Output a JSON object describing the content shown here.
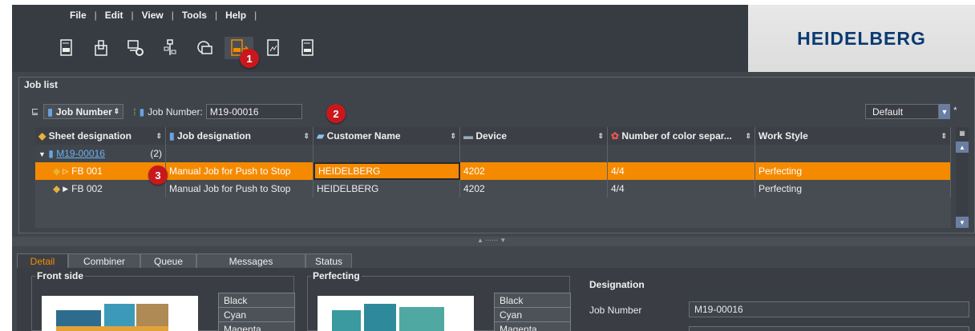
{
  "menu": [
    "File",
    "Edit",
    "View",
    "Tools",
    "Help"
  ],
  "toolbar_icons": [
    "job-sheet-icon",
    "stacker-icon",
    "workstation-settings-icon",
    "tree-icon",
    "network-print-icon",
    "push-to-stop-icon",
    "report-icon",
    "job-report-icon"
  ],
  "logo": "HEIDELBERG",
  "badges": [
    "1",
    "2",
    "3"
  ],
  "joblist": {
    "title": "Job list",
    "group_by": "Job Number",
    "filter_label": "Job Number:",
    "filter_value": "M19-00016",
    "view_select": "Default",
    "asterisk": "*"
  },
  "columns": [
    "Sheet designation",
    "Job designation",
    "Customer Name",
    "Device",
    "Number of color separ...",
    "Work Style"
  ],
  "group_row": {
    "job_number": "M19-00016",
    "count": "(2)"
  },
  "rows": [
    {
      "sheet": "FB 001",
      "job": "Manual Job for Push to Stop",
      "customer": "HEIDELBERG",
      "device": "4202",
      "colors": "4/4",
      "style": "Perfecting"
    },
    {
      "sheet": "FB 002",
      "job": "Manual Job for Push to Stop",
      "customer": "HEIDELBERG",
      "device": "4202",
      "colors": "4/4",
      "style": "Perfecting"
    }
  ],
  "tabs": [
    "Detail",
    "Combiner",
    "Queue",
    "Messages",
    "Status"
  ],
  "detail": {
    "front_title": "Front side",
    "perfecting_title": "Perfecting",
    "front_seps": [
      "Black",
      "Cyan",
      "Magenta"
    ],
    "perf_seps": [
      "Black",
      "Cyan",
      "Magenta"
    ],
    "designation_title": "Designation",
    "job_number_label": "Job Number",
    "job_number_value": "M19-00016"
  },
  "colors": {
    "selection": "#f58a00",
    "badge": "#c8181e",
    "logo": "#0a3a72"
  }
}
